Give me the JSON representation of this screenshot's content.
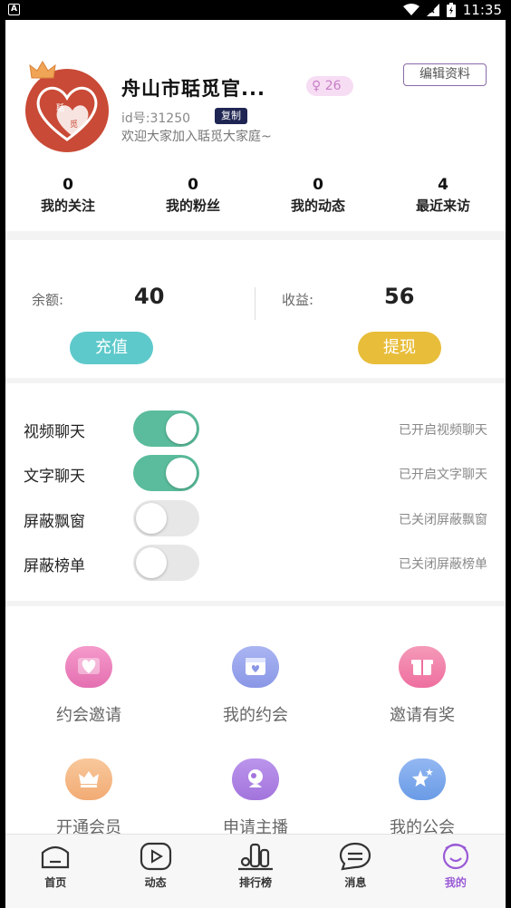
{
  "status_bar": {
    "time": "11:35",
    "a_icon": "A"
  },
  "profile": {
    "name": "舟山市聒觅官...",
    "badge_value": "26",
    "edit_label": "编辑资料",
    "id_text": "id号:31250",
    "copy_label": "复制",
    "welcome": "欢迎大家加入聒觅大家庭~",
    "avatar_text_1": "聒",
    "avatar_text_2": "觅"
  },
  "stats": [
    {
      "value": "0",
      "label": "我的关注"
    },
    {
      "value": "0",
      "label": "我的粉丝"
    },
    {
      "value": "0",
      "label": "我的动态"
    },
    {
      "value": "4",
      "label": "最近来访"
    }
  ],
  "wallet": {
    "balance_label": "余额:",
    "balance_value": "40",
    "recharge_label": "充值",
    "income_label": "收益:",
    "income_value": "56",
    "withdraw_label": "提现"
  },
  "toggles": [
    {
      "label": "视频聊天",
      "on": true,
      "status": "已开启视频聊天"
    },
    {
      "label": "文字聊天",
      "on": true,
      "status": "已开启文字聊天"
    },
    {
      "label": "屏蔽飘窗",
      "on": false,
      "status": "已关闭屏蔽飘窗"
    },
    {
      "label": "屏蔽榜单",
      "on": false,
      "status": "已关闭屏蔽榜单"
    }
  ],
  "grid": [
    {
      "label": "约会邀请",
      "icon": "heart-icon",
      "color": "#e46fb1"
    },
    {
      "label": "我的约会",
      "icon": "calendar-icon",
      "color": "#8a97e6"
    },
    {
      "label": "邀请有奖",
      "icon": "gift-icon",
      "color": "#ee6f9f"
    },
    {
      "label": "开通会员",
      "icon": "crown-icon",
      "color": "#f2ab74"
    },
    {
      "label": "申请主播",
      "icon": "anchor-icon",
      "color": "#a274dc"
    },
    {
      "label": "我的公会",
      "icon": "star-icon",
      "color": "#6a9be6"
    }
  ],
  "tabs": [
    {
      "label": "首页",
      "icon": "home-icon"
    },
    {
      "label": "动态",
      "icon": "play-icon"
    },
    {
      "label": "排行榜",
      "icon": "ranking-icon"
    },
    {
      "label": "消息",
      "icon": "message-icon"
    },
    {
      "label": "我的",
      "icon": "profile-icon",
      "active": true
    }
  ],
  "colors": {
    "recharge": "#5ec9cb",
    "withdraw": "#e8bd3a",
    "switch_on": "#5abc9c",
    "active_tab": "#9a5ad6"
  }
}
